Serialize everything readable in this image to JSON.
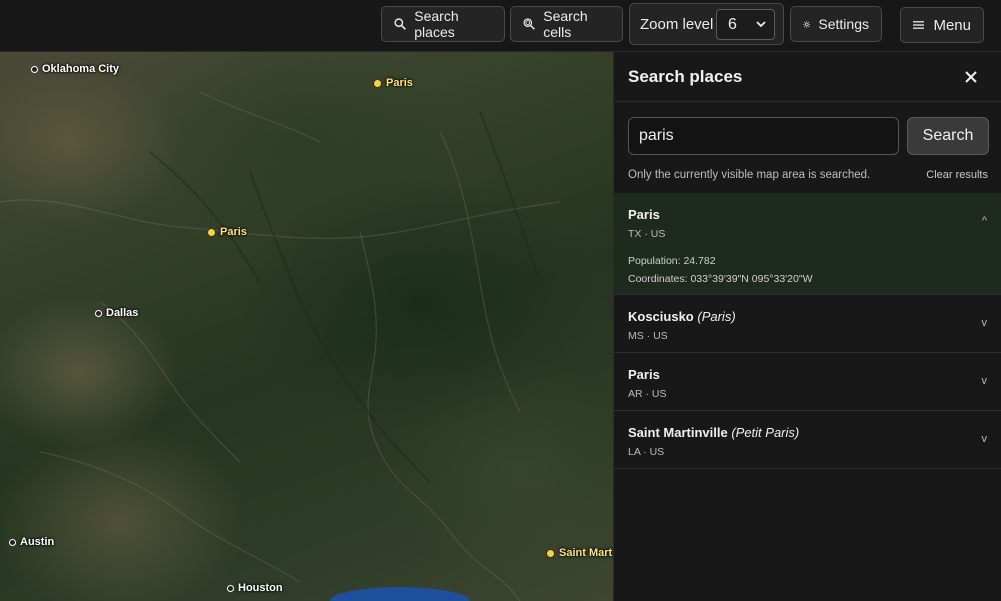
{
  "toolbar": {
    "search_places_label": "Search places",
    "search_cells_label": "Search cells",
    "zoom_label": "Zoom level",
    "zoom_value": "6",
    "settings_label": "Settings",
    "menu_label": "Menu"
  },
  "map": {
    "cities": [
      {
        "name": "Oklahoma City",
        "highlighted": false
      },
      {
        "name": "Paris",
        "highlighted": true
      },
      {
        "name": "Paris",
        "highlighted": true
      },
      {
        "name": "Dallas",
        "highlighted": false
      },
      {
        "name": "Austin",
        "highlighted": false
      },
      {
        "name": "Houston",
        "highlighted": false
      },
      {
        "name": "Saint Martinville",
        "highlighted": true
      }
    ]
  },
  "panel": {
    "title": "Search places",
    "search_value": "paris",
    "search_button": "Search",
    "hint": "Only the currently visible map area is searched.",
    "clear_label": "Clear results",
    "results": [
      {
        "name": "Paris",
        "alt": "",
        "region": "TX · US",
        "expanded": true,
        "population": "Population: 24.782",
        "coordinates": "Coordinates: 033°39'39\"N 095°33'20\"W",
        "toggle": "^"
      },
      {
        "name": "Kosciusko",
        "alt": "(Paris)",
        "region": "MS · US",
        "expanded": false,
        "toggle": "v"
      },
      {
        "name": "Paris",
        "alt": "",
        "region": "AR · US",
        "expanded": false,
        "toggle": "v"
      },
      {
        "name": "Saint Martinville",
        "alt": "(Petit Paris)",
        "region": "LA · US",
        "expanded": false,
        "toggle": "v"
      }
    ]
  }
}
